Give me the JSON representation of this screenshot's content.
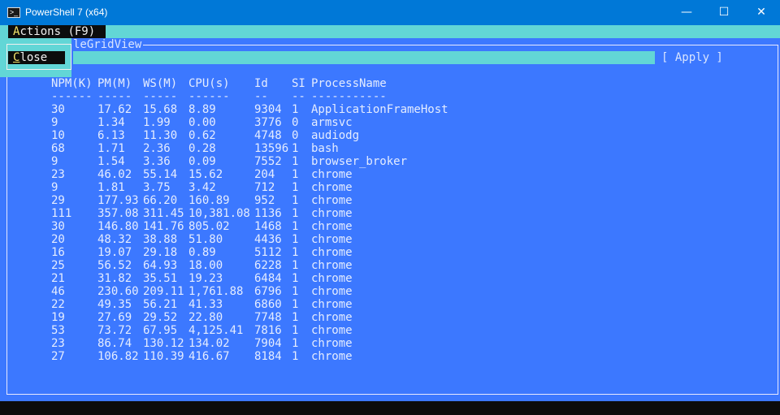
{
  "window": {
    "title": "PowerShell 7 (x64)",
    "minimize": "—",
    "maximize": "☐",
    "close": "✕"
  },
  "menu": {
    "actions_hotkey": "A",
    "actions_rest": "ctions (F9)"
  },
  "frame": {
    "title": "leGridView"
  },
  "filter": {
    "value": "",
    "apply_label": "[ Apply ]"
  },
  "popup": {
    "close_hotkey": "C",
    "close_rest": "lose"
  },
  "table": {
    "headers": [
      "NPM(K)",
      "PM(M)",
      "WS(M)",
      "CPU(s)",
      "Id",
      "SI",
      "ProcessName"
    ],
    "separators": [
      "------",
      "-----",
      "-----",
      "------",
      "--",
      "--",
      "-----------"
    ],
    "rows": [
      [
        "30",
        "17.62",
        "15.68",
        "8.89",
        "9304",
        "1",
        "ApplicationFrameHost"
      ],
      [
        "9",
        "1.34",
        "1.99",
        "0.00",
        "3776",
        "0",
        "armsvc"
      ],
      [
        "10",
        "6.13",
        "11.30",
        "0.62",
        "4748",
        "0",
        "audiodg"
      ],
      [
        "68",
        "1.71",
        "2.36",
        "0.28",
        "13596",
        "1",
        "bash"
      ],
      [
        "9",
        "1.54",
        "3.36",
        "0.09",
        "7552",
        "1",
        "browser_broker"
      ],
      [
        "23",
        "46.02",
        "55.14",
        "15.62",
        "204",
        "1",
        "chrome"
      ],
      [
        "9",
        "1.81",
        "3.75",
        "3.42",
        "712",
        "1",
        "chrome"
      ],
      [
        "29",
        "177.93",
        "66.20",
        "160.89",
        "952",
        "1",
        "chrome"
      ],
      [
        "111",
        "357.08",
        "311.45",
        "10,381.08",
        "1136",
        "1",
        "chrome"
      ],
      [
        "30",
        "146.80",
        "141.76",
        "805.02",
        "1468",
        "1",
        "chrome"
      ],
      [
        "20",
        "48.32",
        "38.88",
        "51.80",
        "4436",
        "1",
        "chrome"
      ],
      [
        "16",
        "19.07",
        "29.18",
        "0.89",
        "5112",
        "1",
        "chrome"
      ],
      [
        "25",
        "56.52",
        "64.93",
        "18.00",
        "6228",
        "1",
        "chrome"
      ],
      [
        "21",
        "31.82",
        "35.51",
        "19.23",
        "6484",
        "1",
        "chrome"
      ],
      [
        "46",
        "230.60",
        "209.11",
        "1,761.88",
        "6796",
        "1",
        "chrome"
      ],
      [
        "22",
        "49.35",
        "56.21",
        "41.33",
        "6860",
        "1",
        "chrome"
      ],
      [
        "19",
        "27.69",
        "29.52",
        "22.80",
        "7748",
        "1",
        "chrome"
      ],
      [
        "53",
        "73.72",
        "67.95",
        "4,125.41",
        "7816",
        "1",
        "chrome"
      ],
      [
        "23",
        "86.74",
        "130.12",
        "134.02",
        "7904",
        "1",
        "chrome"
      ],
      [
        "27",
        "106.82",
        "110.39",
        "416.67",
        "8184",
        "1",
        "chrome"
      ]
    ]
  }
}
